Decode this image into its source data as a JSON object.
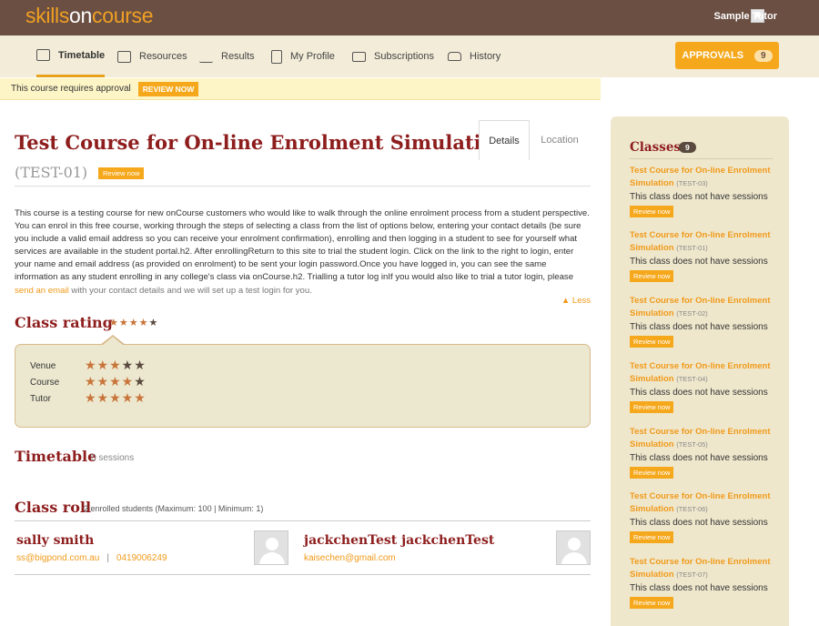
{
  "header": {
    "logo_part1": "skills",
    "logo_part2": "on",
    "logo_part3": "course",
    "user_name": "Sample Tutor"
  },
  "nav": {
    "items": [
      {
        "label": "Timetable",
        "icon": "calendar-icon"
      },
      {
        "label": "Resources",
        "icon": "folder-icon"
      },
      {
        "label": "Results",
        "icon": "bar-chart-icon"
      },
      {
        "label": "My Profile",
        "icon": "profile-icon"
      },
      {
        "label": "Subscriptions",
        "icon": "envelope-icon"
      },
      {
        "label": "History",
        "icon": "inbox-icon"
      }
    ],
    "approvals_label": "APPROVALS",
    "approvals_count": "9"
  },
  "banner": {
    "text": "This course requires approval",
    "button": "REVIEW NOW"
  },
  "course": {
    "title": "Test Course for On-line Enrolment Simulation",
    "code": "(TEST-01)",
    "review_label": "Review now",
    "tabs": [
      "Details",
      "Location"
    ],
    "description": "This course is a testing course for new onCourse customers who would like to walk through the online enrolment process from a student perspective. You can enrol in this free course, working through the steps of selecting a class from the list of options below, entering your contact details (be sure you include a valid email address so you can receive your enrolment confirmation), enrolling and then logging in a student to see for yourself what services are available in the student portal.h2. After enrollingReturn to this site to trial the student login. Click on the link to the right to login, enter your name and email address (as provided on enrolment) to be sent your login password.Once you have logged in, you can see the same information as any student enrolling in any college's class via onCourse.h2. Trialling a tutor log inIf you would also like to trial a tutor login, please ",
    "description_link": "send an email",
    "description_end": " with your contact details and we will set up a test login for you.",
    "less_label": "Less"
  },
  "rating": {
    "title": "Class rating",
    "overall_stars": 4,
    "rows": [
      {
        "label": "Venue",
        "stars": 3
      },
      {
        "label": "Course",
        "stars": 4
      },
      {
        "label": "Tutor",
        "stars": 5
      }
    ]
  },
  "timetable": {
    "title": "Timetable",
    "note": "0 sessions"
  },
  "roll": {
    "title": "Class roll",
    "note": "2 enrolled students (Maximum: 100 | Minimum: 1)",
    "students": [
      {
        "name": "sally smith",
        "email": "ss@bigpond.com.au",
        "phone": "0419006249"
      },
      {
        "name": "jackchenTest jackchenTest",
        "email": "kaisechen@gmail.com",
        "phone": ""
      }
    ]
  },
  "sidebar": {
    "title": "Classes",
    "count": "9",
    "items": [
      {
        "name": "Test Course for On-line Enrolment Simulation",
        "code": "(TEST-03)",
        "status": "This class does not have sessions",
        "review": "Review now"
      },
      {
        "name": "Test Course for On-line Enrolment Simulation",
        "code": "(TEST-01)",
        "status": "This class does not have sessions",
        "review": "Review now"
      },
      {
        "name": "Test Course for On-line Enrolment Simulation",
        "code": "(TEST-02)",
        "status": "This class does not have sessions",
        "review": "Review now"
      },
      {
        "name": "Test Course for On-line Enrolment Simulation",
        "code": "(TEST-04)",
        "status": "This class does not have sessions",
        "review": "Review now"
      },
      {
        "name": "Test Course for On-line Enrolment Simulation",
        "code": "(TEST-05)",
        "status": "This class does not have sessions",
        "review": "Review now"
      },
      {
        "name": "Test Course for On-line Enrolment Simulation",
        "code": "(TEST-06)",
        "status": "This class does not have sessions",
        "review": "Review now"
      },
      {
        "name": "Test Course for On-line Enrolment Simulation",
        "code": "(TEST-07)",
        "status": "This class does not have sessions",
        "review": "Review now"
      }
    ]
  },
  "colors": {
    "brand_brown": "#6b4f43",
    "accent_orange": "#f6a81c",
    "title_red": "#8e1d1d"
  }
}
